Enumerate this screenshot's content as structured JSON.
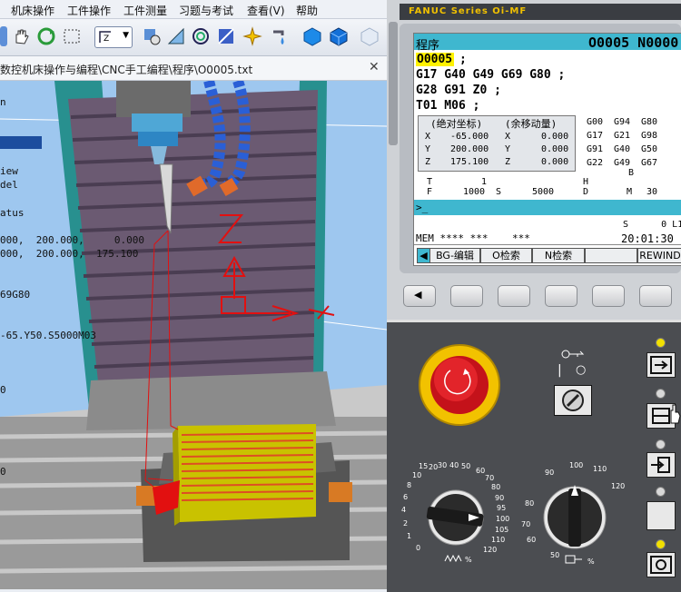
{
  "menu": [
    "机床操作",
    "工件操作",
    "工件测量",
    "习题与考试",
    "查看(V)",
    "帮助"
  ],
  "path_text": "数控机床操作与编程\\CNC手工编程\\程序\\O0005.txt",
  "left_panel": {
    "lines": [
      "n",
      "iew",
      "del",
      "atus",
      "000,  200.000,     0.000",
      "000,  200.000,  175.100",
      "69G80",
      "-65.Y50.S5000M03",
      "0",
      "0"
    ]
  },
  "fanuc": {
    "logo": "FANUC Series Oi-MF",
    "screen_title": "程序",
    "program_no": "O0005 N0000",
    "current_prog": "O0005",
    "program_lines": [
      "G17 G40 G49 G69 G80 ;",
      "G28 G91 Z0 ;",
      "T01 M06 ;"
    ],
    "abs_label": "(绝对坐标)",
    "dist_label": "(余移动量)",
    "axes": [
      {
        "axis": "X",
        "abs": "-65.000",
        "rem": "0.000"
      },
      {
        "axis": "Y",
        "abs": "200.000",
        "rem": "0.000"
      },
      {
        "axis": "Z",
        "abs": "175.100",
        "rem": "0.000"
      }
    ],
    "modal": [
      [
        "G00",
        "G94",
        "G80"
      ],
      [
        "G17",
        "G21",
        "G98"
      ],
      [
        "G91",
        "G40",
        "G50"
      ],
      [
        "G22",
        "G49",
        "G67"
      ]
    ],
    "modal_b": "B",
    "t_label": "T",
    "t_value": "1",
    "h_label": "H",
    "f_label": "F",
    "f_value": "1000",
    "s_label": "S",
    "s_value": "5000",
    "d_label": "D",
    "m_label": "M",
    "m_value": "30",
    "prompt": ">_",
    "s_status": "S      0 L1",
    "mem_status": "MEM **** ***    ***",
    "clock": "20:01:30",
    "softkeys": [
      "BG-编辑",
      "O检索",
      "N检索",
      "",
      "REWIND"
    ]
  },
  "feed_dial": {
    "scale": [
      "0",
      "1",
      "2",
      "4",
      "6",
      "8",
      "10",
      "15",
      "20",
      "30",
      "40",
      "50",
      "60",
      "70",
      "80",
      "90",
      "95",
      "100",
      "105",
      "110",
      "120"
    ]
  },
  "spindle_dial": {
    "scale": [
      "50",
      "60",
      "70",
      "80",
      "90",
      "100",
      "110",
      "120"
    ]
  },
  "colors": {
    "lcd_header": "#3fb7cf",
    "highlight": "#fff200",
    "machine_panel": "#4b4d51",
    "column": "#6b5a72"
  }
}
